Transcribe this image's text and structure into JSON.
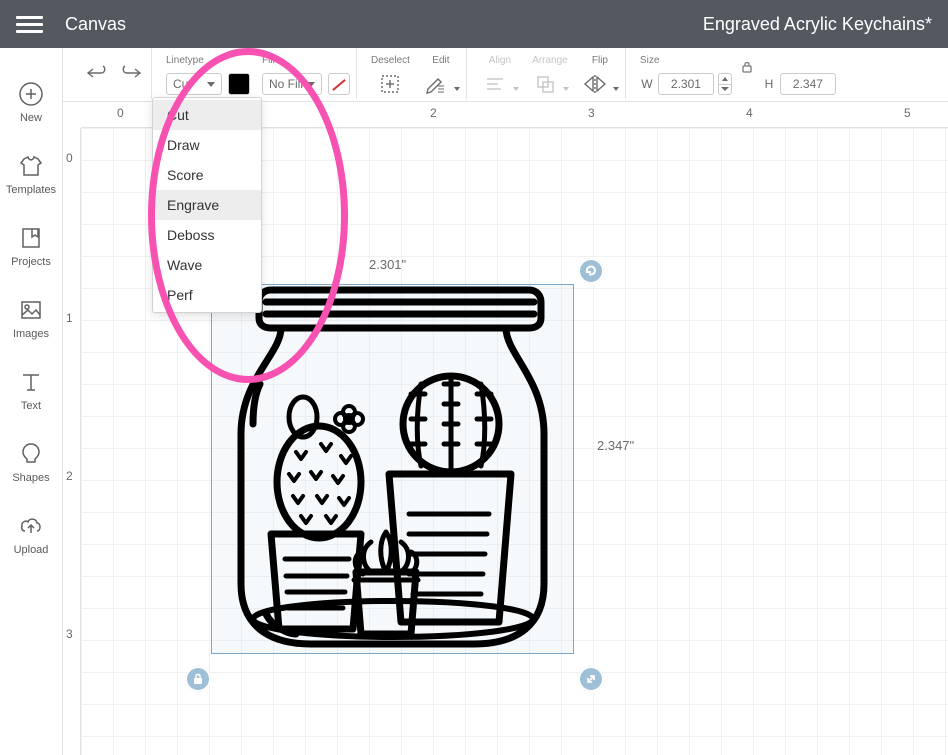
{
  "header": {
    "app_title": "Canvas",
    "project_title": "Engraved Acrylic Keychains*"
  },
  "sidebar": {
    "items": [
      {
        "label": "New"
      },
      {
        "label": "Templates"
      },
      {
        "label": "Projects"
      },
      {
        "label": "Images"
      },
      {
        "label": "Text"
      },
      {
        "label": "Shapes"
      },
      {
        "label": "Upload"
      }
    ]
  },
  "toolbar": {
    "linetype_label": "Linetype",
    "linetype_value": "Cut",
    "fill_label": "Fill",
    "fill_value": "No Fill",
    "deselect_label": "Deselect",
    "edit_label": "Edit",
    "align_label": "Align",
    "arrange_label": "Arrange",
    "flip_label": "Flip",
    "size_label": "Size",
    "size_w_label": "W",
    "size_w_value": "2.301",
    "size_h_label": "H",
    "size_h_value": "2.347"
  },
  "linetype_options": [
    "Cut",
    "Draw",
    "Score",
    "Engrave",
    "Deboss",
    "Wave",
    "Perf"
  ],
  "linetype_highlight": [
    "Cut",
    "Engrave"
  ],
  "ruler": {
    "h": [
      "0",
      "2",
      "3",
      "4",
      "5"
    ],
    "v": [
      "0",
      "1",
      "2",
      "3"
    ]
  },
  "canvas": {
    "dim_w": "2.301\"",
    "dim_h": "2.347\""
  }
}
